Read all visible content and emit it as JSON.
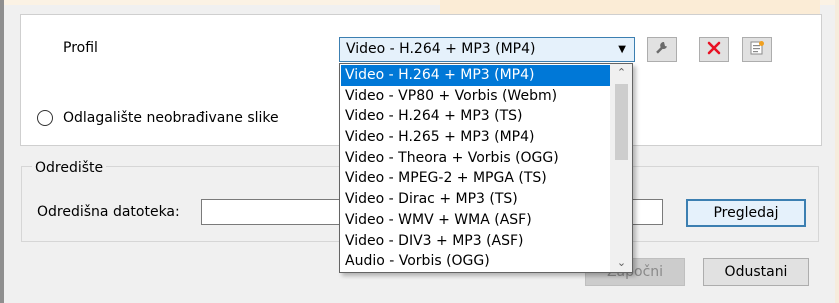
{
  "profile": {
    "label": "Profil",
    "selected": "Video - H.264 + MP3 (MP4)",
    "options": [
      "Video - H.264 + MP3 (MP4)",
      "Video - VP80 + Vorbis (Webm)",
      "Video - H.264 + MP3 (TS)",
      "Video - H.265 + MP3 (MP4)",
      "Video - Theora + Vorbis (OGG)",
      "Video - MPEG-2 + MPGA (TS)",
      "Video - Dirac + MP3 (TS)",
      "Video - WMV + WMA (ASF)",
      "Video - DIV3 + MP3 (ASF)",
      "Audio - Vorbis (OGG)"
    ],
    "edit_icon": "wrench-icon",
    "delete_icon": "red-x-icon",
    "new_icon": "new-profile-icon"
  },
  "raw_dump": {
    "label": "Odlagalište neobrađivane slike"
  },
  "destination": {
    "group_title": "Odredište",
    "file_label": "Odredišna datoteka:",
    "file_value": "",
    "browse_label": "Pregledaj"
  },
  "actions": {
    "start_label": "Započni",
    "cancel_label": "Odustani"
  },
  "colors": {
    "selection": "#0078d7",
    "focus_border": "#3c7fb1",
    "delete_red": "#e81123"
  }
}
